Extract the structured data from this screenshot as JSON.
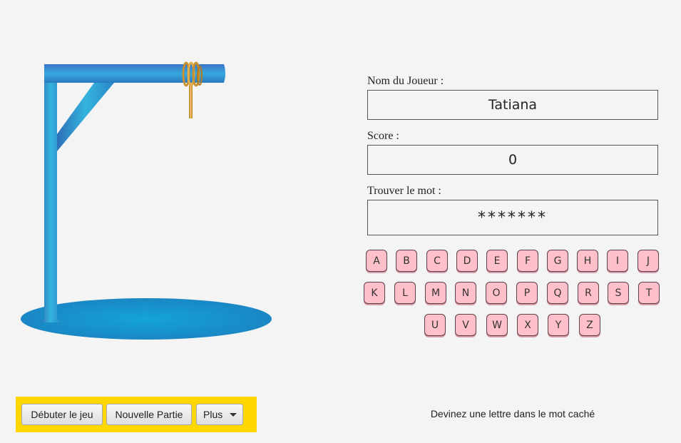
{
  "fields": {
    "player_label": "Nom du Joueur :",
    "player_name": "Tatiana",
    "score_label": "Score :",
    "score_value": "0",
    "word_label": "Trouver le mot :",
    "hidden_word": "*******"
  },
  "keyboard": {
    "letters": [
      "A",
      "B",
      "C",
      "D",
      "E",
      "F",
      "G",
      "H",
      "I",
      "J",
      "K",
      "L",
      "M",
      "N",
      "O",
      "P",
      "Q",
      "R",
      "S",
      "T",
      "U",
      "V",
      "W",
      "X",
      "Y",
      "Z"
    ],
    "key_color": "#ffc0cb"
  },
  "toolbar": {
    "start_label": "Débuter le jeu",
    "new_game_label": "Nouvelle Partie",
    "more_label": "Plus",
    "bar_color": "#ffd700"
  },
  "status": {
    "message": "Devinez une lettre dans le mot caché"
  },
  "colors": {
    "gallows": "#2a9fd0",
    "rope": "#d4a24a"
  }
}
